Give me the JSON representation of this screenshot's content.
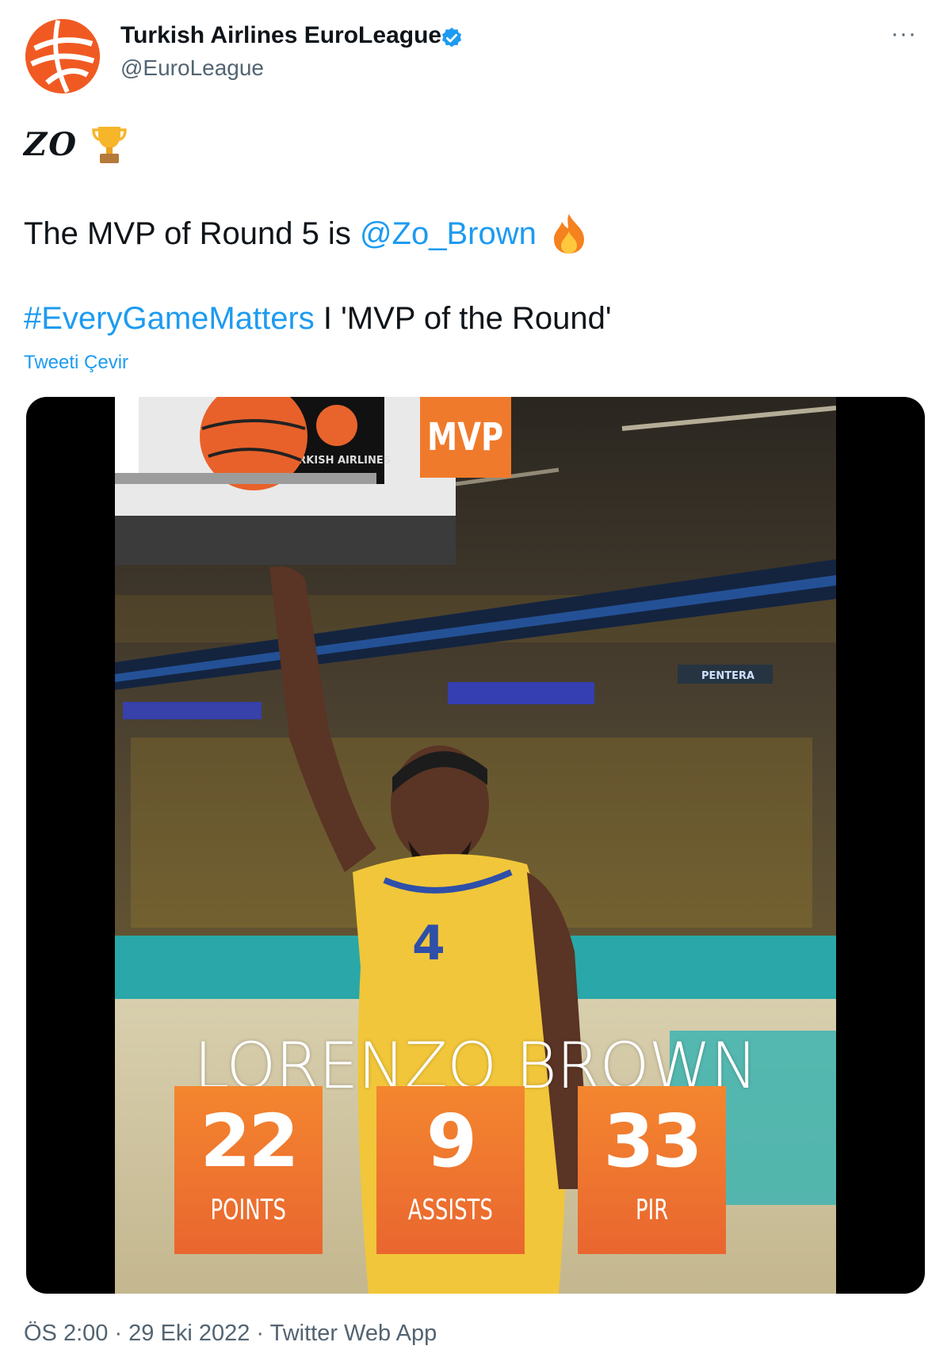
{
  "account": {
    "display_name": "Turkish Airlines EuroLeague",
    "handle": "@EuroLeague",
    "verified": true,
    "avatar_icon": "euroleague-logo-icon",
    "brand_color": "#f05a22"
  },
  "menu": {
    "more_label": "···"
  },
  "tweet": {
    "line1": {
      "text": "ZO",
      "emoji": "🏆",
      "emoji_icon": "trophy-icon"
    },
    "line2": {
      "prefix": "The MVP of Round 5 is ",
      "mention": "@Zo_Brown",
      "emoji": "🔥",
      "emoji_icon": "fire-icon"
    },
    "line3": {
      "hashtag": "#EveryGameMatters",
      "suffix": " I 'MVP of the Round'"
    },
    "translate_label": "Tweeti Çevir",
    "link_color": "#1d9bf0"
  },
  "media": {
    "badge": "MVP",
    "player_name": "LORENZO BROWN",
    "board_text": "TURKISH AIRLINES",
    "sponsor_text": "PENTERA",
    "stats": [
      {
        "value": "22",
        "label": "POINTS"
      },
      {
        "value": "9",
        "label": "ASSISTS"
      },
      {
        "value": "33",
        "label": "PIR"
      }
    ],
    "accent_color": "#f07a2b"
  },
  "footer": {
    "timestamp": "ÖS 2:00 · 29 Eki 2022 · Twitter Web App"
  }
}
